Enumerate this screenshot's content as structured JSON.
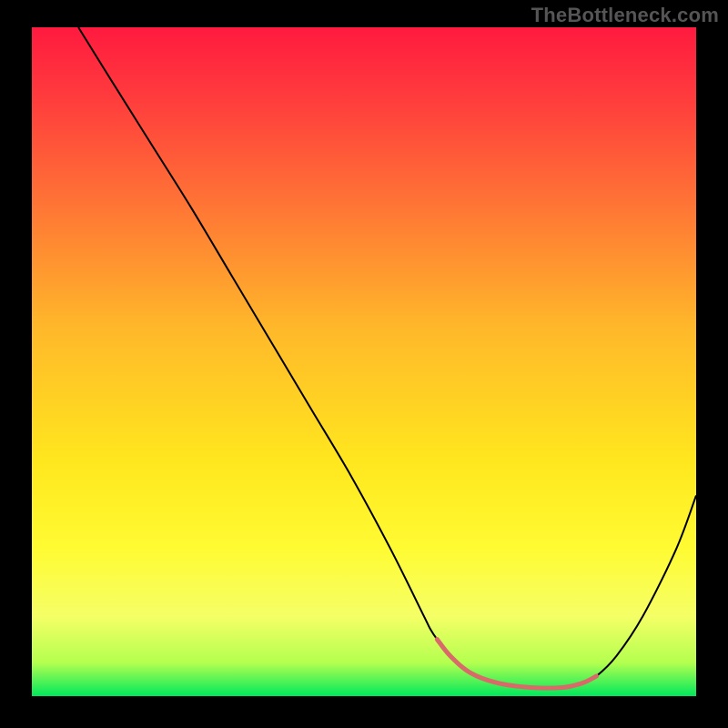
{
  "watermark": "TheBottleneck.com",
  "chart_data": {
    "type": "line",
    "title": "",
    "xlabel": "",
    "ylabel": "",
    "xlim": [
      0,
      100
    ],
    "ylim": [
      0,
      100
    ],
    "grid": false,
    "legend": false,
    "background_gradient": {
      "direction": "vertical",
      "stops": [
        {
          "offset": 0.0,
          "color": "#ff1a3f"
        },
        {
          "offset": 0.1,
          "color": "#ff3a3d"
        },
        {
          "offset": 0.25,
          "color": "#ff6f36"
        },
        {
          "offset": 0.45,
          "color": "#ffb82a"
        },
        {
          "offset": 0.65,
          "color": "#ffe71e"
        },
        {
          "offset": 0.78,
          "color": "#fffb33"
        },
        {
          "offset": 0.88,
          "color": "#f5ff66"
        },
        {
          "offset": 0.95,
          "color": "#b4ff4f"
        },
        {
          "offset": 1.0,
          "color": "#00e85c"
        }
      ]
    },
    "series": [
      {
        "name": "bottleneck-curve",
        "stroke": "#000000",
        "stroke_width": 2,
        "x": [
          7,
          12,
          18,
          24,
          30,
          36,
          42,
          48,
          54,
          59,
          60,
          61,
          63,
          66,
          70,
          75,
          80,
          83,
          85,
          88,
          92,
          97,
          100
        ],
        "y": [
          100,
          92,
          82.5,
          73,
          63,
          53,
          43,
          33,
          22,
          12,
          10,
          8.5,
          6,
          3.5,
          2,
          1.3,
          1.3,
          2,
          3,
          6,
          12,
          22,
          30
        ]
      }
    ],
    "trough_marker": {
      "name": "optimal-range-marker",
      "stroke": "#d96a6a",
      "stroke_width": 5,
      "x": [
        61,
        63,
        66,
        70,
        75,
        80,
        83,
        85
      ],
      "y": [
        8.5,
        6,
        3.5,
        2,
        1.3,
        1.3,
        2,
        3
      ]
    }
  }
}
